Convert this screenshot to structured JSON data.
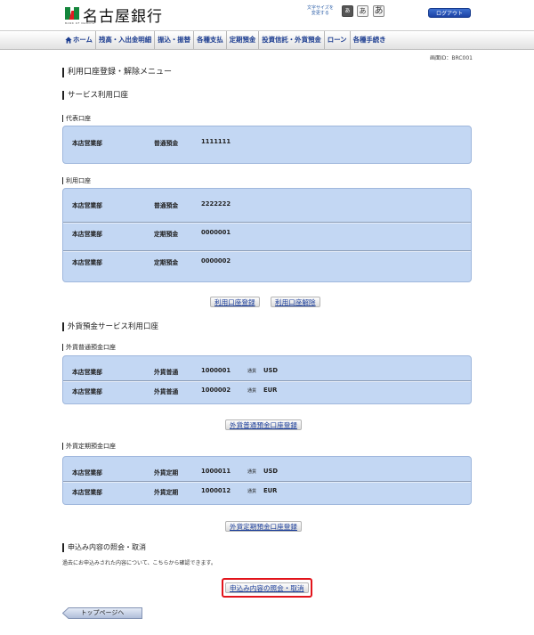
{
  "header": {
    "bank_name": "名古屋銀行",
    "logo_subtext": "BANK OF NAGOYA",
    "font_size_label_line1": "文字サイズを",
    "font_size_label_line2": "変更する",
    "font_small": "あ",
    "font_medium": "あ",
    "font_large": "あ",
    "logout_label": "ログアウト"
  },
  "nav": {
    "items": [
      {
        "label": "ホーム"
      },
      {
        "label": "残高・入出金明細"
      },
      {
        "label": "振込・振替"
      },
      {
        "label": "各種支払"
      },
      {
        "label": "定期預金"
      },
      {
        "label": "投資信託・外貨預金"
      },
      {
        "label": "ローン"
      },
      {
        "label": "各種手続き"
      }
    ]
  },
  "screen_id": "画面ID：BRC001",
  "page_title": "利用口座登録・解除メニュー",
  "service_section": {
    "title": "サービス利用口座",
    "representative": {
      "title": "代表口座",
      "rows": [
        {
          "branch": "本店営業部",
          "type": "普通預金",
          "number": "1111111"
        }
      ]
    },
    "usage": {
      "title": "利用口座",
      "rows": [
        {
          "branch": "本店営業部",
          "type": "普通預金",
          "number": "2222222"
        },
        {
          "branch": "本店営業部",
          "type": "定期預金",
          "number": "0000001"
        },
        {
          "branch": "本店営業部",
          "type": "定期預金",
          "number": "0000002"
        }
      ]
    },
    "register_button": "利用口座登録",
    "cancel_button": "利用口座解除"
  },
  "forex_section": {
    "title": "外貨預金サービス利用口座",
    "ordinary": {
      "title": "外貨普通預金口座",
      "rows": [
        {
          "branch": "本店営業部",
          "type": "外貨普通",
          "number": "1000001",
          "currency_label": "通貨",
          "currency": "USD"
        },
        {
          "branch": "本店営業部",
          "type": "外貨普通",
          "number": "1000002",
          "currency_label": "通貨",
          "currency": "EUR"
        }
      ],
      "button": "外貨普通預金口座登録"
    },
    "time": {
      "title": "外貨定期預金口座",
      "rows": [
        {
          "branch": "本店営業部",
          "type": "外貨定期",
          "number": "1000011",
          "currency_label": "通貨",
          "currency": "USD"
        },
        {
          "branch": "本店営業部",
          "type": "外貨定期",
          "number": "1000012",
          "currency_label": "通貨",
          "currency": "EUR"
        }
      ],
      "button": "外貨定期預金口座登録"
    }
  },
  "inquiry_section": {
    "title": "申込み内容の照会・取消",
    "note": "過去にお申込みされた内容について、こちらから確認できます。",
    "button": "申込み内容の照会・取消"
  },
  "top_page_button": "トップページへ",
  "colors": {
    "panel": "#c3d7f3",
    "nav_text": "#1a3b8f",
    "logout": "#1c43a5",
    "highlight": "#e2141b"
  }
}
